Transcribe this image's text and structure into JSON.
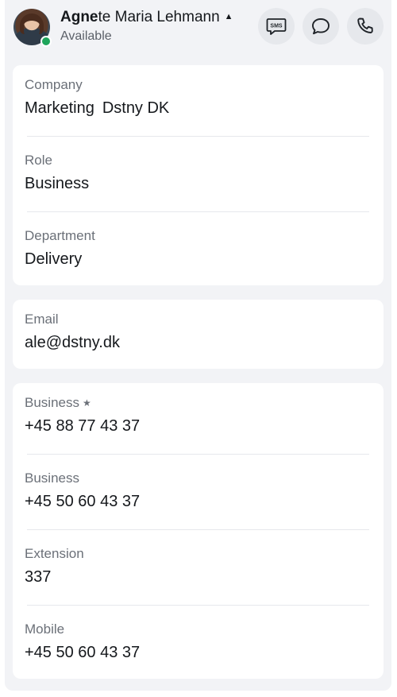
{
  "header": {
    "name_bold": "Agne",
    "name_rest": "te Maria Lehmann",
    "presence": "Available",
    "sms_label": "SMS",
    "icons": {
      "avatar": "user-photo",
      "status": "online-dot",
      "caret": "caret-up-icon",
      "sms": "sms-icon",
      "chat": "chat-bubble-icon",
      "call": "phone-icon"
    },
    "status_color": "#1fa55b"
  },
  "organization": {
    "company_label": "Company",
    "company_value_1": "Marketing",
    "company_value_2": "Dstny DK",
    "role_label": "Role",
    "role_value": "Business",
    "department_label": "Department",
    "department_value": "Delivery"
  },
  "email": {
    "label": "Email",
    "value": "ale@dstny.dk"
  },
  "phones": [
    {
      "label": "Business",
      "value": "+45 88 77 43 37",
      "preferred": true
    },
    {
      "label": "Business",
      "value": "+45 50 60 43 37",
      "preferred": false
    },
    {
      "label": "Extension",
      "value": "337",
      "preferred": false
    },
    {
      "label": "Mobile",
      "value": "+45 50 60 43 37",
      "preferred": false
    }
  ]
}
